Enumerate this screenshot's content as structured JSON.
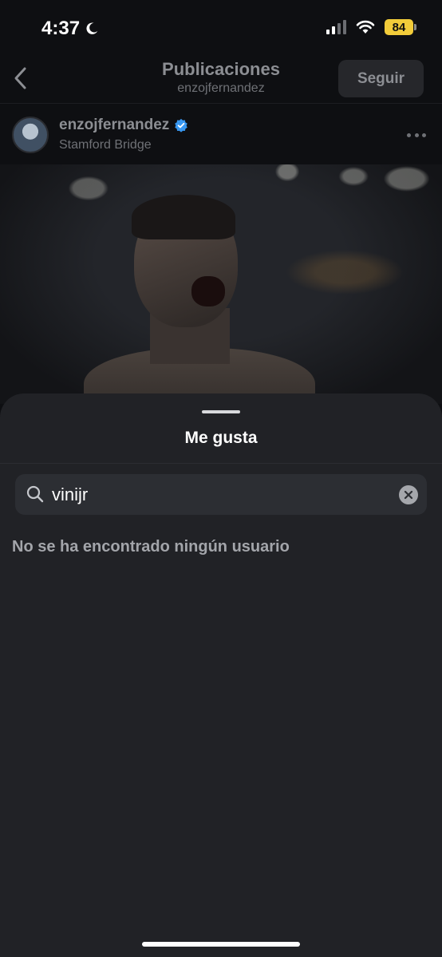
{
  "status_bar": {
    "time": "4:37",
    "battery_level": "84",
    "moon_icon": "moon-icon",
    "signal_icon": "cellular-signal-icon",
    "wifi_icon": "wifi-icon"
  },
  "header": {
    "title": "Publicaciones",
    "subtitle": "enzojfernandez",
    "follow_label": "Seguir",
    "back_icon": "chevron-left-icon"
  },
  "post": {
    "username": "enzojfernandez",
    "location": "Stamford Bridge",
    "verified_icon": "verified-badge-icon",
    "more_icon": "more-horizontal-icon"
  },
  "likes_sheet": {
    "title": "Me gusta",
    "search": {
      "value": "vinijr",
      "search_icon": "search-icon",
      "clear_icon": "clear-icon"
    },
    "empty_message": "No se ha encontrado ningún usuario"
  },
  "colors": {
    "sheet_background": "#212226",
    "search_background": "#2c2e33",
    "battery": "#f2cc3a",
    "verified": "#3897f0"
  }
}
